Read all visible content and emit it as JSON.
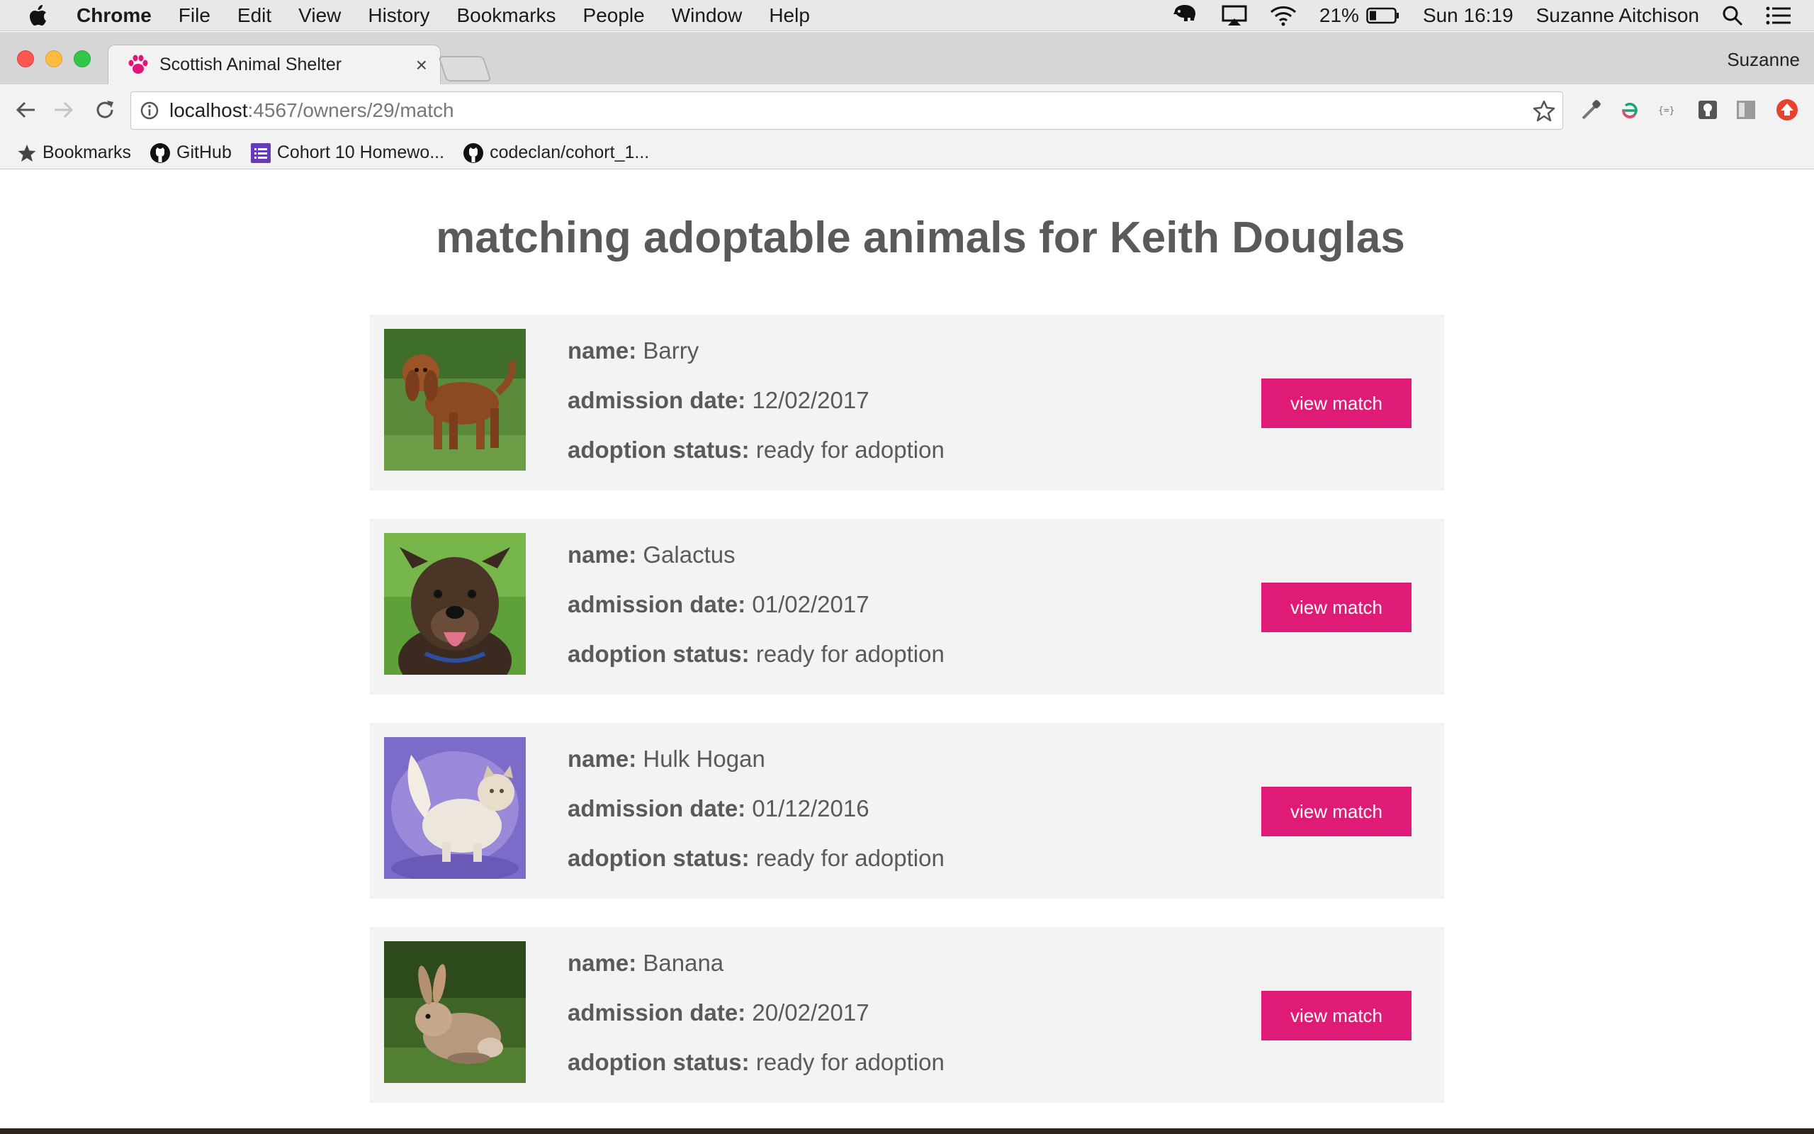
{
  "menubar": {
    "app_name": "Chrome",
    "items": [
      "File",
      "Edit",
      "View",
      "History",
      "Bookmarks",
      "People",
      "Window",
      "Help"
    ],
    "battery": "21%",
    "clock": "Sun 16:19",
    "user": "Suzanne Aitchison"
  },
  "browser": {
    "tab_title": "Scottish Animal Shelter",
    "tab_close": "×",
    "profile_name": "Suzanne",
    "url_host": "localhost",
    "url_path": ":4567/owners/29/match",
    "bookmarks": [
      "Bookmarks",
      "GitHub",
      "Cohort 10 Homewo...",
      "codeclan/cohort_1..."
    ]
  },
  "page": {
    "title": "matching adoptable animals for Keith Douglas",
    "labels": {
      "name": "name:",
      "admission": "admission date:",
      "status": "adoption status:"
    },
    "animals": [
      {
        "name": "Barry",
        "admission_date": "12/02/2017",
        "adoption_status": "ready for adoption",
        "button": "view match",
        "photo": "brown-dog-photo"
      },
      {
        "name": "Galactus",
        "admission_date": "01/02/2017",
        "adoption_status": "ready for adoption",
        "button": "view match",
        "photo": "brindle-dog-photo"
      },
      {
        "name": "Hulk Hogan",
        "admission_date": "01/12/2016",
        "adoption_status": "ready for adoption",
        "button": "view match",
        "photo": "white-cat-photo"
      },
      {
        "name": "Banana",
        "admission_date": "20/02/2017",
        "adoption_status": "ready for adoption",
        "button": "view match",
        "photo": "rabbit-photo"
      }
    ]
  },
  "colors": {
    "accent": "#e01b77",
    "card_bg": "#f3f3f3",
    "text": "#5a5a5a"
  }
}
